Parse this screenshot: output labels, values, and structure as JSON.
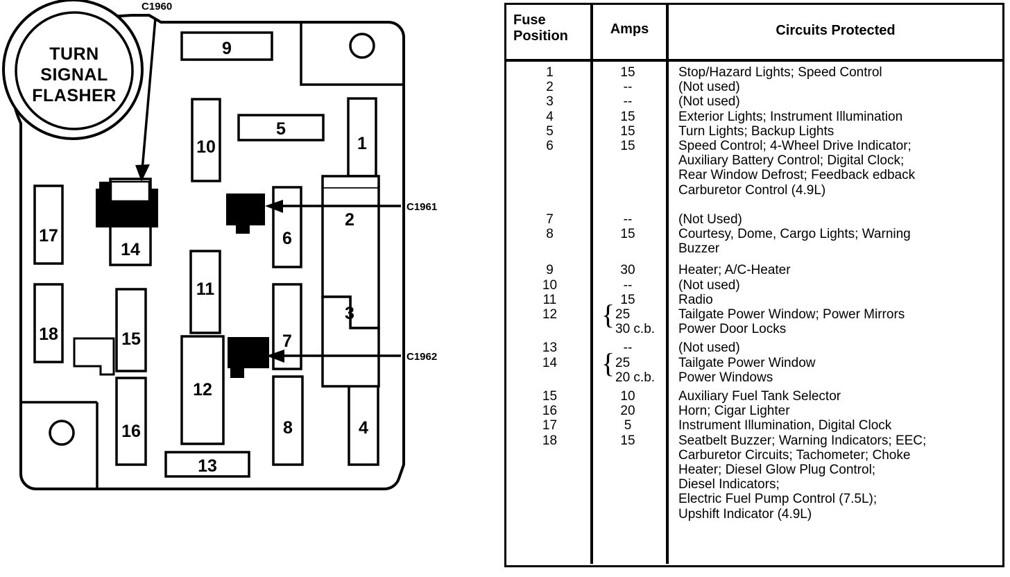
{
  "diagram": {
    "flasher_label_lines": [
      "TURN",
      "SIGNAL",
      "FLASHER"
    ],
    "connector_labels": {
      "c1960": "C1960",
      "c1961": "C1961",
      "c1962": "C1962"
    },
    "fuse_slots": [
      {
        "id": "1",
        "label": "1"
      },
      {
        "id": "2",
        "label": "2"
      },
      {
        "id": "3",
        "label": "3"
      },
      {
        "id": "4",
        "label": "4"
      },
      {
        "id": "5",
        "label": "5"
      },
      {
        "id": "6",
        "label": "6"
      },
      {
        "id": "7",
        "label": "7"
      },
      {
        "id": "8",
        "label": "8"
      },
      {
        "id": "9",
        "label": "9"
      },
      {
        "id": "10",
        "label": "10"
      },
      {
        "id": "11",
        "label": "11"
      },
      {
        "id": "12",
        "label": "12"
      },
      {
        "id": "13",
        "label": "13"
      },
      {
        "id": "14",
        "label": "14"
      },
      {
        "id": "15",
        "label": "15"
      },
      {
        "id": "16",
        "label": "16"
      },
      {
        "id": "17",
        "label": "17"
      },
      {
        "id": "18",
        "label": "18"
      }
    ]
  },
  "table": {
    "headers": {
      "position": "Fuse\nPosition",
      "position_line1": "Fuse",
      "position_line2": "Position",
      "amps": "Amps",
      "circuits": "Circuits Protected"
    },
    "rows": [
      {
        "pos": "1",
        "amps": [
          "15"
        ],
        "brace": false,
        "circuits": [
          "Stop/Hazard Lights; Speed Control"
        ]
      },
      {
        "pos": "2",
        "amps": [
          "--"
        ],
        "brace": false,
        "circuits": [
          "(Not used)"
        ]
      },
      {
        "pos": "3",
        "amps": [
          "--"
        ],
        "brace": false,
        "circuits": [
          "(Not used)"
        ]
      },
      {
        "pos": "4",
        "amps": [
          "15"
        ],
        "brace": false,
        "circuits": [
          "Exterior Lights; Instrument Illumination"
        ]
      },
      {
        "pos": "5",
        "amps": [
          "15"
        ],
        "brace": false,
        "circuits": [
          "Turn Lights; Backup Lights"
        ]
      },
      {
        "pos": "6",
        "amps": [
          "15"
        ],
        "brace": false,
        "circuits": [
          "Speed Control; 4-Wheel Drive Indicator;",
          "Auxiliary Battery Control; Digital Clock;",
          "Rear Window Defrost; Feedback edback",
          "Carburetor Control (4.9L)"
        ]
      },
      {
        "pos": "7",
        "amps": [
          "--"
        ],
        "brace": false,
        "circuits": [
          "(Not Used)"
        ]
      },
      {
        "pos": "8",
        "amps": [
          "15"
        ],
        "brace": false,
        "circuits": [
          "Courtesy, Dome, Cargo Lights; Warning",
          "Buzzer"
        ]
      },
      {
        "pos": "9",
        "amps": [
          "30"
        ],
        "brace": false,
        "circuits": [
          "Heater; A/C-Heater"
        ]
      },
      {
        "pos": "10",
        "amps": [
          "--"
        ],
        "brace": false,
        "circuits": [
          "(Not used)"
        ]
      },
      {
        "pos": "11",
        "amps": [
          "15"
        ],
        "brace": false,
        "circuits": [
          "Radio"
        ]
      },
      {
        "pos": "12",
        "amps": [
          "25",
          "30 c.b."
        ],
        "brace": true,
        "circuits": [
          "Tailgate Power Window; Power Mirrors",
          "Power Door Locks"
        ]
      },
      {
        "pos": "13",
        "amps": [
          "--"
        ],
        "brace": false,
        "circuits": [
          "(Not used)"
        ]
      },
      {
        "pos": "14",
        "amps": [
          "25",
          "20 c.b."
        ],
        "brace": true,
        "circuits": [
          "Tailgate Power Window",
          "Power Windows"
        ]
      },
      {
        "pos": "15",
        "amps": [
          "10"
        ],
        "brace": false,
        "circuits": [
          "Auxiliary Fuel Tank Selector"
        ]
      },
      {
        "pos": "16",
        "amps": [
          "20"
        ],
        "brace": false,
        "circuits": [
          "Horn; Cigar Lighter"
        ]
      },
      {
        "pos": "17",
        "amps": [
          "5"
        ],
        "brace": false,
        "circuits": [
          "Instrument Illumination, Digital Clock"
        ]
      },
      {
        "pos": "18",
        "amps": [
          "15"
        ],
        "brace": false,
        "circuits": [
          "Seatbelt Buzzer; Warning Indicators; EEC;",
          "Carburetor Circuits; Tachometer; Choke",
          "Heater; Diesel Glow Plug Control;",
          "Diesel Indicators;",
          "Electric Fuel Pump Control (7.5L);",
          "Upshift Indicator (4.9L)"
        ]
      }
    ]
  },
  "colors": {
    "ink": "#000000",
    "paper": "#ffffff"
  }
}
